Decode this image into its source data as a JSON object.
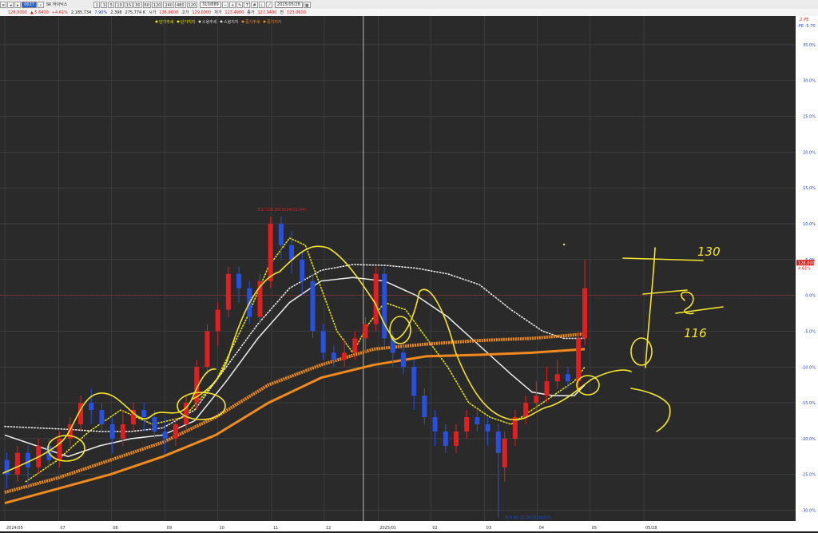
{
  "toolbar": {
    "code_input": "0027",
    "stock_name": "SK 하이닉스",
    "period_buttons": [
      "1",
      "3",
      "5",
      "10",
      "15",
      "30",
      "60",
      "120",
      "240",
      "480",
      "120"
    ],
    "count_input": "310/889",
    "date_input": "2025/05/28"
  },
  "quote": {
    "price": "128.0000",
    "change": "▲ 5.6400",
    "change_pct": "+4.61%",
    "volume": "2,185,734",
    "volume_ratio": "7.90%",
    "turnover": "2.398",
    "amount": "275,774 K",
    "open_label": "시가",
    "open": "126.9800",
    "high_label": "고가",
    "high": "129.0000",
    "low_label": "저가",
    "low": "123.4900",
    "close_label": "종가",
    "close": "127.9400",
    "prev_label": "전",
    "prev": "123.0600"
  },
  "legend": [
    {
      "label": "단기추세",
      "color": "#e8e800"
    },
    {
      "label": "단기지지",
      "color": "#e8e800"
    },
    {
      "label": "스윙추세",
      "color": "#dddddd"
    },
    {
      "label": "스윙지지",
      "color": "#dddddd"
    },
    {
      "label": "중기추세",
      "color": "#f08a1c"
    },
    {
      "label": "중기지지",
      "color": "#f08a1c"
    }
  ],
  "right_axis_header": [
    "고 PE",
    "-PE  -5.70"
  ],
  "price_badge": [
    "128.0000",
    "4.61%"
  ],
  "annotations": {
    "high_marker": "최고 136.35(2024/11/04)",
    "low_marker": "최저 90.21(2025/04/07)",
    "hand_130": "130",
    "hand_116": "116"
  },
  "chart_data": {
    "type": "line",
    "title": "",
    "xlabel": "",
    "ylabel": "",
    "y_unit": "% from current price",
    "ylim": [
      -31.5,
      39
    ],
    "y_ticks": [
      "35.0%",
      "30.0%",
      "25.0%",
      "20.0%",
      "15.0%",
      "10.0%",
      "5.0%",
      "0.0%",
      "-5.0%",
      "-10.0%",
      "-15.0%",
      "-20.0%",
      "-25.0%",
      "-30.0%"
    ],
    "y_tick_values": [
      35,
      30,
      25,
      20,
      15,
      10,
      5,
      0,
      -5,
      -10,
      -15,
      -20,
      -25,
      -30
    ],
    "x_labels": [
      "2024/05",
      "07",
      "08",
      "09",
      "10",
      "11",
      "12",
      "2025/01",
      "02",
      "03",
      "04",
      "05",
      "05/28"
    ],
    "x_label_pos": [
      0,
      51,
      101,
      152,
      202,
      253,
      303,
      354,
      404,
      455,
      505,
      555,
      606
    ],
    "x_range": [
      0,
      606
    ],
    "candles": [
      {
        "x": 2,
        "o": -23,
        "c": -25,
        "h": -22,
        "l": -27
      },
      {
        "x": 12,
        "o": -25,
        "c": -22,
        "h": -21,
        "l": -26
      },
      {
        "x": 22,
        "o": -22,
        "c": -24,
        "h": -21,
        "l": -27
      },
      {
        "x": 32,
        "o": -24,
        "c": -21,
        "h": -20,
        "l": -25
      },
      {
        "x": 42,
        "o": -21,
        "c": -23,
        "h": -20,
        "l": -24
      },
      {
        "x": 52,
        "o": -23,
        "c": -20,
        "h": -19,
        "l": -24
      },
      {
        "x": 62,
        "o": -20,
        "c": -18,
        "h": -17,
        "l": -21
      },
      {
        "x": 72,
        "o": -18,
        "c": -15,
        "h": -14,
        "l": -19
      },
      {
        "x": 82,
        "o": -15,
        "c": -16,
        "h": -13,
        "l": -18
      },
      {
        "x": 92,
        "o": -16,
        "c": -18,
        "h": -15,
        "l": -19
      },
      {
        "x": 102,
        "o": -18,
        "c": -20,
        "h": -17,
        "l": -22
      },
      {
        "x": 112,
        "o": -20,
        "c": -18,
        "h": -16,
        "l": -21
      },
      {
        "x": 122,
        "o": -18,
        "c": -16,
        "h": -15,
        "l": -19
      },
      {
        "x": 132,
        "o": -16,
        "c": -17,
        "h": -15,
        "l": -19
      },
      {
        "x": 142,
        "o": -17,
        "c": -19,
        "h": -16,
        "l": -20
      },
      {
        "x": 152,
        "o": -19,
        "c": -20,
        "h": -17,
        "l": -22
      },
      {
        "x": 162,
        "o": -20,
        "c": -18,
        "h": -17,
        "l": -21
      },
      {
        "x": 172,
        "o": -18,
        "c": -15,
        "h": -14,
        "l": -19
      },
      {
        "x": 182,
        "o": -15,
        "c": -10,
        "h": -9,
        "l": -16
      },
      {
        "x": 192,
        "o": -10,
        "c": -5,
        "h": -4,
        "l": -11
      },
      {
        "x": 202,
        "o": -5,
        "c": -2,
        "h": -1,
        "l": -7
      },
      {
        "x": 212,
        "o": -2,
        "c": 3,
        "h": 4,
        "l": -3
      },
      {
        "x": 222,
        "o": 3,
        "c": 1,
        "h": 4,
        "l": -1
      },
      {
        "x": 232,
        "o": 1,
        "c": -3,
        "h": 2,
        "l": -4
      },
      {
        "x": 242,
        "o": -3,
        "c": 2,
        "h": 3,
        "l": -4
      },
      {
        "x": 252,
        "o": 2,
        "c": 10,
        "h": 11,
        "l": 1
      },
      {
        "x": 262,
        "o": 10,
        "c": 7,
        "h": 11,
        "l": 5
      },
      {
        "x": 272,
        "o": 7,
        "c": 5,
        "h": 9,
        "l": 3
      },
      {
        "x": 282,
        "o": 5,
        "c": 2,
        "h": 6,
        "l": 0
      },
      {
        "x": 292,
        "o": 2,
        "c": -5,
        "h": 3,
        "l": -6
      },
      {
        "x": 302,
        "o": -5,
        "c": -8,
        "h": -4,
        "l": -9
      },
      {
        "x": 312,
        "o": -8,
        "c": -9,
        "h": -7,
        "l": -10
      },
      {
        "x": 322,
        "o": -9,
        "c": -8,
        "h": -6,
        "l": -10
      },
      {
        "x": 332,
        "o": -8,
        "c": -6,
        "h": -5,
        "l": -9
      },
      {
        "x": 342,
        "o": -6,
        "c": -4,
        "h": -3,
        "l": -8
      },
      {
        "x": 352,
        "o": -4,
        "c": 3,
        "h": 4,
        "l": -5
      },
      {
        "x": 360,
        "o": 3,
        "c": -6,
        "h": 4,
        "l": -7
      },
      {
        "x": 368,
        "o": -6,
        "c": -8,
        "h": -5,
        "l": -10
      },
      {
        "x": 378,
        "o": -8,
        "c": -10,
        "h": -7,
        "l": -11
      },
      {
        "x": 388,
        "o": -10,
        "c": -14,
        "h": -9,
        "l": -16
      },
      {
        "x": 398,
        "o": -14,
        "c": -17,
        "h": -13,
        "l": -18
      },
      {
        "x": 408,
        "o": -17,
        "c": -19,
        "h": -16,
        "l": -21
      },
      {
        "x": 418,
        "o": -19,
        "c": -21,
        "h": -18,
        "l": -22
      },
      {
        "x": 428,
        "o": -21,
        "c": -19,
        "h": -18,
        "l": -22
      },
      {
        "x": 438,
        "o": -19,
        "c": -17,
        "h": -16,
        "l": -20
      },
      {
        "x": 448,
        "o": -17,
        "c": -18,
        "h": -16,
        "l": -19
      },
      {
        "x": 458,
        "o": -18,
        "c": -19,
        "h": -17,
        "l": -21
      },
      {
        "x": 468,
        "o": -19,
        "c": -22,
        "h": -18,
        "l": -31
      },
      {
        "x": 474,
        "o": -24,
        "c": -20,
        "h": -19,
        "l": -26
      },
      {
        "x": 484,
        "o": -20,
        "c": -17,
        "h": -16,
        "l": -21
      },
      {
        "x": 494,
        "o": -17,
        "c": -15,
        "h": -14,
        "l": -18
      },
      {
        "x": 504,
        "o": -15,
        "c": -14,
        "h": -12,
        "l": -16
      },
      {
        "x": 514,
        "o": -14,
        "c": -12,
        "h": -10,
        "l": -15
      },
      {
        "x": 524,
        "o": -12,
        "c": -11,
        "h": -9,
        "l": -13
      },
      {
        "x": 534,
        "o": -11,
        "c": -12,
        "h": -10,
        "l": -13
      },
      {
        "x": 544,
        "o": -12,
        "c": -6,
        "h": -5,
        "l": -13
      },
      {
        "x": 550,
        "o": -6,
        "c": 1,
        "h": 5,
        "l": -7
      }
    ],
    "series": [
      {
        "name": "단기추세",
        "style": "dotted",
        "color": "#e8e800",
        "x": [
          20,
          50,
          80,
          110,
          140,
          170,
          200,
          230,
          250,
          270,
          285,
          300,
          315,
          330,
          345,
          360,
          380,
          400,
          420,
          440,
          460,
          480,
          500,
          520,
          540,
          550
        ],
        "y": [
          -26,
          -23,
          -19,
          -16,
          -18,
          -17,
          -12,
          -3,
          4,
          8,
          7,
          1,
          -5,
          -8,
          -4,
          -1,
          -2,
          -6,
          -10,
          -15,
          -17,
          -18,
          -16,
          -14,
          -12,
          -10
        ]
      },
      {
        "name": "스윙추세",
        "style": "dotted",
        "color": "#eeeeee",
        "x": [
          0,
          30,
          60,
          90,
          120,
          150,
          180,
          210,
          240,
          270,
          300,
          330,
          360,
          390,
          420,
          450,
          480,
          510,
          530,
          550
        ],
        "y": [
          -18.3,
          -18.5,
          -18.7,
          -19,
          -19,
          -18.5,
          -16,
          -10,
          -4,
          1,
          3.5,
          4.3,
          4.2,
          3.8,
          3,
          1.5,
          -2,
          -5,
          -6,
          -6
        ]
      },
      {
        "name": "스윙지지",
        "style": "solid",
        "color": "#eeeeee",
        "x": [
          0,
          30,
          60,
          90,
          120,
          150,
          180,
          210,
          240,
          270,
          300,
          330,
          360,
          390,
          420,
          450,
          480,
          500,
          520,
          540,
          550
        ],
        "y": [
          -19.5,
          -21,
          -22.5,
          -21,
          -20,
          -19.5,
          -17.5,
          -12,
          -6,
          -1,
          2,
          2.5,
          2,
          0,
          -3,
          -7,
          -11,
          -13.5,
          -14,
          -14,
          -12.5
        ]
      },
      {
        "name": "중기추세",
        "style": "thick-dotted",
        "color": "#f08a1c",
        "x": [
          0,
          50,
          100,
          150,
          200,
          250,
          300,
          350,
          400,
          450,
          500,
          550
        ],
        "y": [
          -27.5,
          -25.5,
          -23,
          -20.5,
          -17,
          -12.5,
          -9.7,
          -7.5,
          -6.8,
          -6.3,
          -6,
          -5.4
        ]
      },
      {
        "name": "중기지지",
        "style": "solid",
        "color": "#f08a1c",
        "x": [
          0,
          50,
          100,
          150,
          200,
          250,
          300,
          350,
          400,
          450,
          500,
          550
        ],
        "y": [
          -29,
          -27,
          -25,
          -22.5,
          -19.5,
          -15,
          -11.5,
          -9.7,
          -8.5,
          -8.3,
          -8,
          -7.5
        ]
      }
    ]
  },
  "colors": {
    "background": "#000000",
    "grid": "#444444",
    "up_candle": "#e02020",
    "down_candle": "#2850e0",
    "highlight": "#f5e62a",
    "zero_line": "#c02020"
  }
}
